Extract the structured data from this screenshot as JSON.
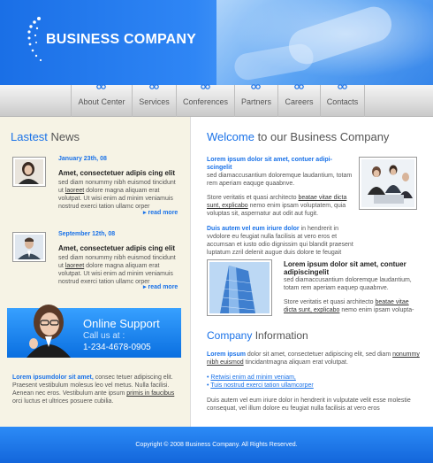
{
  "header": {
    "logo_text": "BUSINESS COMPANY"
  },
  "nav": [
    "About Center",
    "Services",
    "Conferences",
    "Partners",
    "Careers",
    "Contacts"
  ],
  "news": {
    "title_a": "Lastest",
    "title_b": " News",
    "items": [
      {
        "date": "January 23th, 08",
        "title": "Amet, consectetuer adipis cing elit",
        "text_a": "sed diam nonummy nibh euismod tincidunt ut ",
        "link": "laoreet",
        "text_b": " dolore magna aliquam erat volutpat.  Ut wisi enim ad minim veniamuis nostrud exerci tation ullamc orper",
        "more": "read more"
      },
      {
        "date": "September 12th, 08",
        "title": "Amet, consectetuer adipis cing elit",
        "text_a": "sed diam nonummy nibh euismod tincidunt ut ",
        "link": "laoreet",
        "text_b": " dolore magna aliquam erat volutpat.  Ut wisi enim ad minim veniamuis nostrud exerci tation ullamc orper",
        "more": "read more"
      }
    ]
  },
  "support": {
    "title": "Online Support",
    "call": "Call us at :",
    "phone": "1-234-4678-0905"
  },
  "left_bottom": {
    "lead": "Lorem ipsumdolor sit amet,",
    "text_a": " consec tetuer adipiscing elit.  Praesent vestibulum molesus leo vel metus.  Nulla facilisi.  Aenean nec eros.  Vestibulum ante ipsum ",
    "link": "primis in faucibus",
    "text_b": " orci luctus et ultrices posuere cubilia."
  },
  "welcome": {
    "title_a": "Welcome",
    "title_b": " to our Business Company",
    "p1_lead": "Lorem ipsum dolor sit amet, contuer adipi-scingelit",
    "p1_text": "sed diamaccusantium doloremque laudantium, totam rem aperiam eaquge quaabnve.",
    "p2_text_a": "Store veritatis et quasi architecto ",
    "p2_link": "beatae vitae dicta sunt, explicabo",
    "p2_text_b": " nemo enim ipsam voluptatem, quia voluptas sit, aspernatur aut odit aut fugit.",
    "p3_lead": "Duis autem vel eum iriure dolor",
    "p3_text": " in hendrerit in vvdolore eu feugiat nulla facilisis at vero eros et accumsan et iusto odio dignissim qui blandit praesent luptatum zzril delenit augue duis dolore te feugait",
    "p4_title": "Lorem ipsum dolor sit amet, contuer adipiscingelit",
    "p4_text": "sed diamaccusantium doloremque laudantium, totam rem aperiam eaquep quaabnve.",
    "p5_text_a": "Store veritatis et quasi architecto ",
    "p5_link": "beatae vitae dicta sunt, explicabo",
    "p5_text_b": " nemo enim ipsam volupta-"
  },
  "info": {
    "title_a": "Company",
    "title_b": " Information",
    "lead": "Lorem ipsum",
    "text_a": " dolor sit amet, consectetuer adipiscing elit, sed diam ",
    "link": "nonummy nibh euismod",
    "text_b": " tincidantmagna aliquam erat volutpat.",
    "links": [
      "Retwisi enim ad minim veniam,",
      "Tuis nostrud exerci tation ullamcorper"
    ],
    "bottom": "Duis autem vel eum iriure dolor in hendrerit in vulputate velit esse molestie consequat, vel illum dolore eu feugiat nulla facilisis at vero eros"
  },
  "footer": {
    "copyright": "Copyright © 2008 Business Company.  All Rights Reserved."
  },
  "colors": {
    "accent": "#1a72e8",
    "left_bg": "#f6f3e5",
    "footer": "#1366db"
  }
}
